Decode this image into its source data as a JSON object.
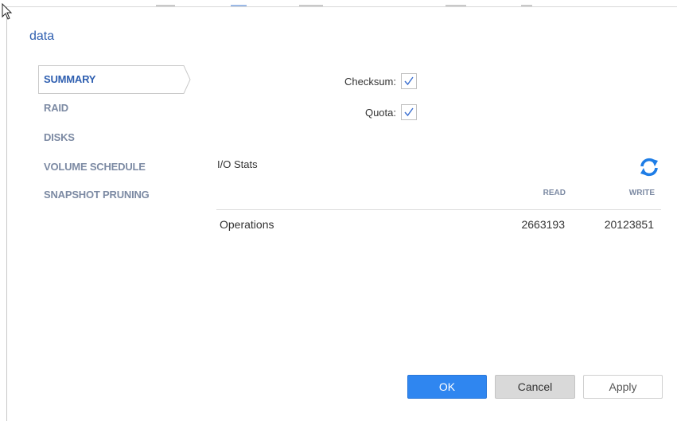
{
  "dialog": {
    "title": "data"
  },
  "nav": {
    "items": [
      {
        "label": "SUMMARY",
        "active": true
      },
      {
        "label": "RAID",
        "active": false
      },
      {
        "label": "DISKS",
        "active": false
      },
      {
        "label": "VOLUME SCHEDULE",
        "active": false
      },
      {
        "label": "SNAPSHOT PRUNING",
        "active": false
      }
    ]
  },
  "options": {
    "checksum": {
      "label": "Checksum:",
      "checked": true
    },
    "quota": {
      "label": "Quota:",
      "checked": true
    }
  },
  "io_stats": {
    "title": "I/O Stats",
    "refresh_icon": "refresh-icon",
    "columns": [
      "READ",
      "WRITE"
    ],
    "rows": [
      {
        "label": "Operations",
        "read": "2663193",
        "write": "20123851"
      }
    ]
  },
  "buttons": {
    "ok": "OK",
    "cancel": "Cancel",
    "apply": "Apply"
  },
  "colors": {
    "accent": "#2f86f0",
    "title_blue": "#2f5fb0",
    "nav_inactive": "#7c8aa3"
  }
}
